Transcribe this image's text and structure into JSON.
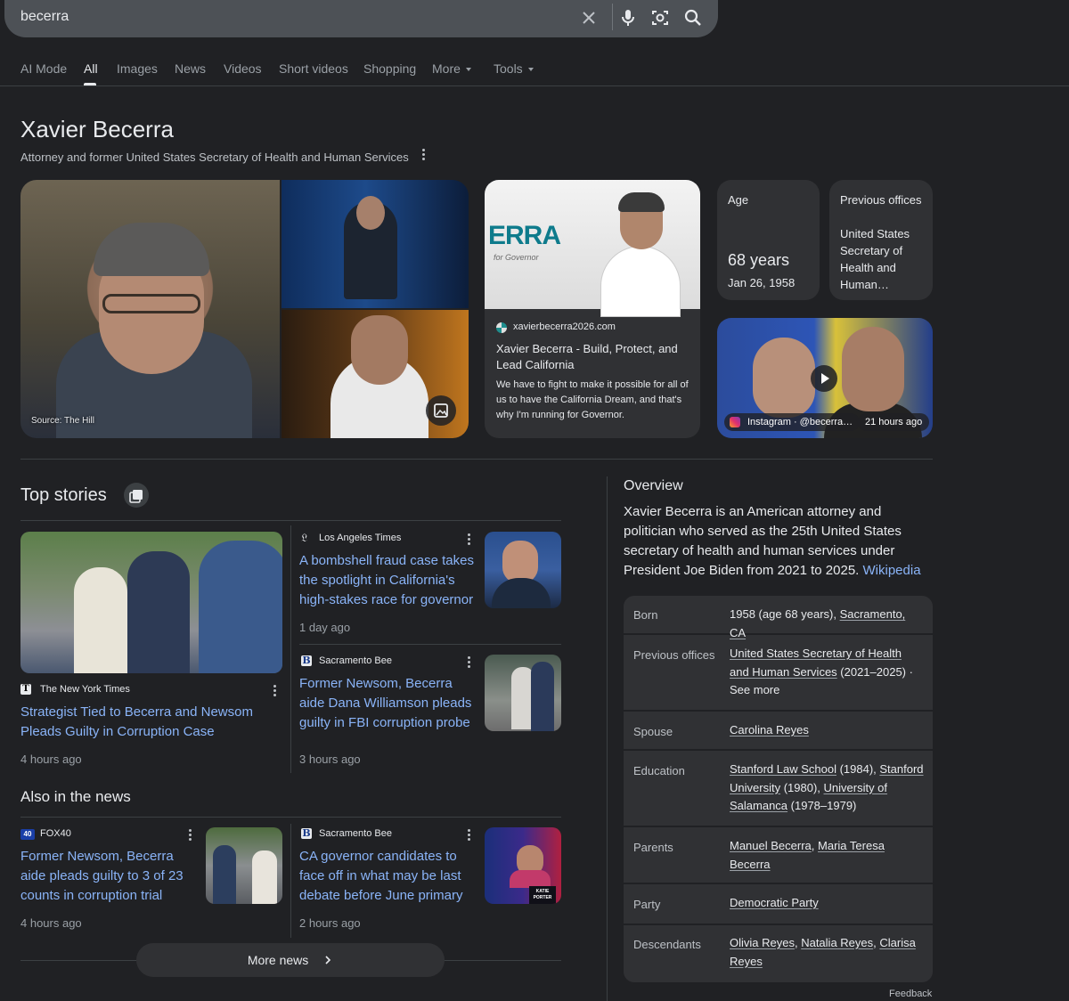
{
  "search": {
    "query": "becerra"
  },
  "tabs": [
    {
      "label": "AI Mode"
    },
    {
      "label": "All"
    },
    {
      "label": "Images"
    },
    {
      "label": "News"
    },
    {
      "label": "Videos"
    },
    {
      "label": "Short videos"
    },
    {
      "label": "Shopping"
    },
    {
      "label": "More"
    },
    {
      "label": "Tools"
    }
  ],
  "entity": {
    "title": "Xavier Becerra",
    "subtitle": "Attorney and former United States Secretary of Health and Human Services",
    "image_source": "Source: The Hill"
  },
  "website_card": {
    "image_brand": "ERRA",
    "image_tagline": "for Governor",
    "domain": "xavierbecerra2026.com",
    "title": "Xavier Becerra - Build, Protect, and Lead California",
    "snippet": "We have to fight to make it possible for all of us to have the California Dream, and that's why I'm running for Governor."
  },
  "age_card": {
    "label": "Age",
    "value": "68 years",
    "date": "Jan 26, 1958"
  },
  "prev_offices_card": {
    "label": "Previous offices",
    "value": "United States Secretary of Health and Human…"
  },
  "instagram_video": {
    "source": "Instagram · @becerra…",
    "time": "21 hours ago"
  },
  "top_stories": {
    "title": "Top stories",
    "stories": [
      {
        "source": "The New York Times",
        "headline": "Strategist Tied to Becerra and Newsom Pleads Guilty in Corruption Case",
        "time": "4 hours ago"
      },
      {
        "source": "Los Angeles Times",
        "headline": "A bombshell fraud case takes the spotlight in California's high-stakes race for governor",
        "time": "1 day ago"
      },
      {
        "source": "Sacramento Bee",
        "headline": "Former Newsom, Becerra aide Dana Williamson pleads guilty in FBI corruption probe",
        "time": "3 hours ago"
      }
    ]
  },
  "also_in_news": {
    "title": "Also in the news",
    "stories": [
      {
        "source": "FOX40",
        "source_badge": "40",
        "headline": "Former Newsom, Becerra aide pleads guilty to 3 of 23 counts in corruption trial",
        "time": "4 hours ago"
      },
      {
        "source": "Sacramento Bee",
        "headline": "CA governor candidates to face off in what may be last debate before June primary",
        "time": "2 hours ago",
        "thumb_text": "KATIE PORTER"
      }
    ],
    "more_label": "More news"
  },
  "overview": {
    "title": "Overview",
    "text": "Xavier Becerra is an American attorney and politician who served as the 25th United States secretary of health and human services under President Joe Biden from 2021 to 2025.",
    "link": "Wikipedia",
    "facts": {
      "born": {
        "key": "Born",
        "pre": "1958 (age 68 years), ",
        "link": "Sacramento, CA"
      },
      "offices": {
        "key": "Previous offices",
        "link": "United States Secretary of Health and Human Services",
        "post": " (2021–2025) · See more"
      },
      "spouse": {
        "key": "Spouse",
        "link": "Carolina Reyes"
      },
      "education": {
        "key": "Education",
        "l1": "Stanford Law School",
        "t1": " (1984), ",
        "l2": "Stanford University",
        "t2": " (1980), ",
        "l3": "University of Salamanca",
        "t3": " (1978–1979)"
      },
      "parents": {
        "key": "Parents",
        "l1": "Manuel Becerra",
        "sep": ", ",
        "l2": "Maria Teresa Becerra"
      },
      "party": {
        "key": "Party",
        "link": "Democratic Party"
      },
      "descendants": {
        "key": "Descendants",
        "l1": "Olivia Reyes",
        "sep1": ", ",
        "l2": "Natalia Reyes",
        "sep2": ", ",
        "l3": "Clarisa Reyes"
      }
    },
    "feedback": "Feedback"
  },
  "colors": {
    "background": "#202124",
    "surface": "#303134",
    "link": "#8ab4f8",
    "text": "#e8eaed",
    "muted": "#9aa0a6"
  }
}
